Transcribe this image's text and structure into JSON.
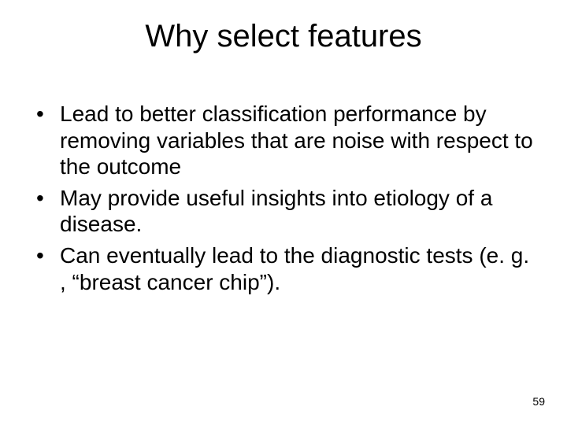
{
  "title": "Why select features",
  "bullets": [
    "Lead to better classification performance by removing variables that are noise with respect to the outcome",
    "May provide useful insights into etiology of a disease.",
    "Can eventually lead to the diagnostic tests (e. g. , “breast cancer chip”)."
  ],
  "page_number": "59"
}
